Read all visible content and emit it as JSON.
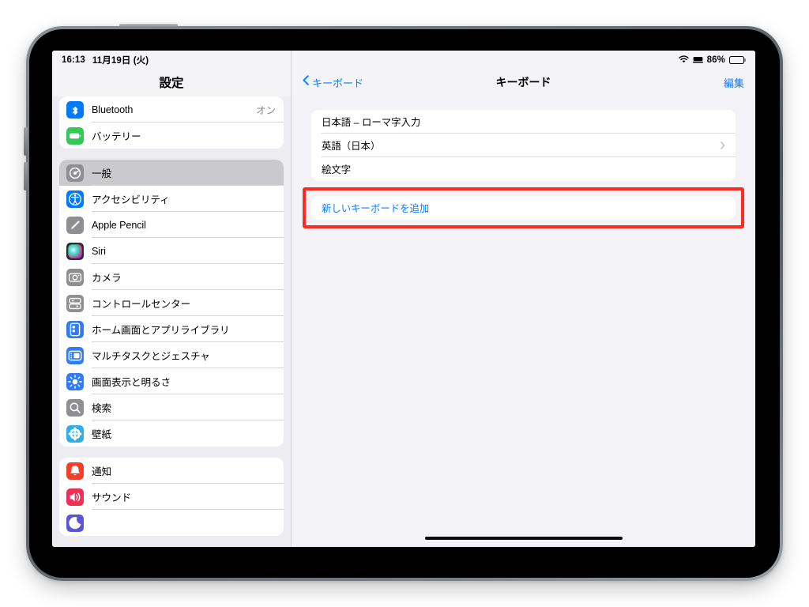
{
  "device": {
    "kind": "ipad",
    "frame_color": "#6e7479",
    "bezel_color": "#000000"
  },
  "status_bar": {
    "time": "16:13",
    "date": "11月19日 (火)",
    "wifi_icon": "wifi-icon",
    "keyboard_icon": "external-keyboard-icon",
    "battery_percent": "86%",
    "battery_icon": "battery-icon",
    "battery_level": 86
  },
  "sidebar": {
    "title": "設定",
    "groups": [
      {
        "name": "connectivity-group",
        "items": [
          {
            "label": "Bluetooth",
            "value": "オン",
            "icon": "bluetooth-icon",
            "icon_color": "#007aff",
            "selected": false
          },
          {
            "label": "バッテリー",
            "value": "",
            "icon": "battery-app-icon",
            "icon_color": "#34c759",
            "selected": false
          }
        ]
      },
      {
        "name": "general-group",
        "items": [
          {
            "label": "一般",
            "value": "",
            "icon": "gear-icon",
            "icon_color": "#8e8e93",
            "selected": true
          },
          {
            "label": "アクセシビリティ",
            "value": "",
            "icon": "accessibility-icon",
            "icon_color": "#007aff",
            "selected": false
          },
          {
            "label": "Apple Pencil",
            "value": "",
            "icon": "apple-pencil-icon",
            "icon_color": "#8e8e93",
            "selected": false
          },
          {
            "label": "Siri",
            "value": "",
            "icon": "siri-icon",
            "icon_color": "#2b2b33",
            "selected": false
          },
          {
            "label": "カメラ",
            "value": "",
            "icon": "camera-icon",
            "icon_color": "#8e8e93",
            "selected": false
          },
          {
            "label": "コントロールセンター",
            "value": "",
            "icon": "control-center-icon",
            "icon_color": "#8e8e93",
            "selected": false
          },
          {
            "label": "ホーム画面とアプリライブラリ",
            "value": "",
            "icon": "home-screen-icon",
            "icon_color": "#2f7cf6",
            "selected": false
          },
          {
            "label": "マルチタスクとジェスチャ",
            "value": "",
            "icon": "multitasking-icon",
            "icon_color": "#2f7cf6",
            "selected": false
          },
          {
            "label": "画面表示と明るさ",
            "value": "",
            "icon": "brightness-icon",
            "icon_color": "#2f7cf6",
            "selected": false
          },
          {
            "label": "検索",
            "value": "",
            "icon": "search-icon",
            "icon_color": "#8e8e93",
            "selected": false
          },
          {
            "label": "壁紙",
            "value": "",
            "icon": "wallpaper-icon",
            "icon_color": "#32ade6",
            "selected": false
          }
        ]
      },
      {
        "name": "notifications-group",
        "items": [
          {
            "label": "通知",
            "value": "",
            "icon": "bell-icon",
            "icon_color": "#f4402a",
            "selected": false
          },
          {
            "label": "サウンド",
            "value": "",
            "icon": "speaker-icon",
            "icon_color": "#f02e56",
            "selected": false
          },
          {
            "label": "",
            "value": "",
            "icon": "focus-icon",
            "icon_color": "#5856d6",
            "selected": false,
            "clipped": true
          }
        ]
      }
    ]
  },
  "detail": {
    "back_label": "キーボード",
    "back_icon": "chevron-left-icon",
    "title": "キーボード",
    "edit_label": "編集",
    "keyboards": [
      {
        "label": "日本語 – ローマ字入力",
        "has_chevron": false
      },
      {
        "label": "英語（日本）",
        "has_chevron": true
      },
      {
        "label": "絵文字",
        "has_chevron": false
      }
    ],
    "add_keyboard_label": "新しいキーボードを追加",
    "highlight_color": "#ff2a21",
    "accent_color": "#0a7cff"
  }
}
